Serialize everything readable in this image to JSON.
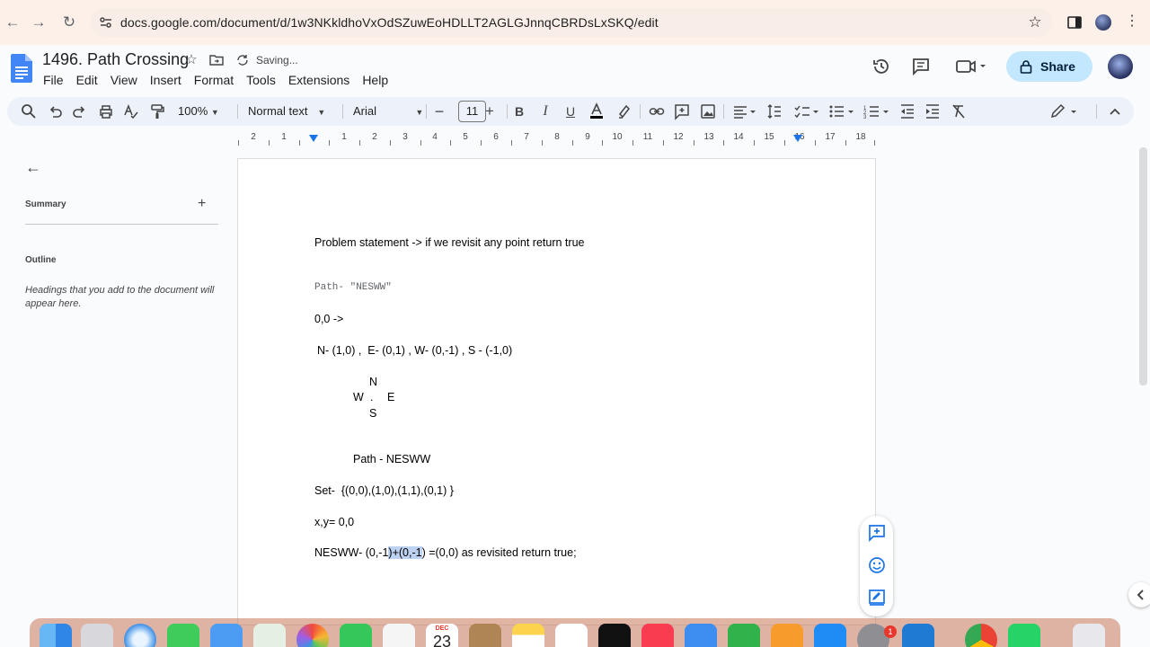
{
  "browser": {
    "url": "docs.google.com/document/d/1w3NKkldhoVxOdSZuwEoHDLLT2AGLGJnnqCBRDsLxSKQ/edit"
  },
  "doc": {
    "title": "1496. Path Crossing",
    "status": "Saving...",
    "share_label": "Share",
    "menu": [
      "File",
      "Edit",
      "View",
      "Insert",
      "Format",
      "Tools",
      "Extensions",
      "Help"
    ]
  },
  "toolbar": {
    "zoom": "100%",
    "style": "Normal text",
    "font": "Arial",
    "font_size": "11"
  },
  "ruler": {
    "labels": [
      "2",
      "1",
      "1",
      "2",
      "3",
      "4",
      "5",
      "6",
      "7",
      "8",
      "9",
      "10",
      "11",
      "12",
      "13",
      "14",
      "15",
      "16",
      "17",
      "18"
    ]
  },
  "sidebar": {
    "summary_label": "Summary",
    "outline_label": "Outline",
    "outline_hint": "Headings that you add to the document will appear here."
  },
  "content": {
    "line1": "Problem statement -> if we revisit any point return true",
    "line2": "Path- \"NESWW\"",
    "line3": "0,0 ->",
    "line4": "N- (1,0) ,  E- (0,1) , W- (0,-1) , S - (-1,0)",
    "compass_n": "N",
    "compass_w": "W",
    "compass_dot": ".",
    "compass_e": "E",
    "compass_s": "S",
    "line5": "Path - NESWW",
    "line6": "Set-  {(0,0),(1,0),(1,1),(0,1) }",
    "line7": "x,y= 0,0",
    "line8_pre": "NESWW- (0,-1",
    "line8_hl": ")+(0,-1",
    "line8_post": ") =(0,0) as revisited return true;"
  },
  "dock": {
    "calendar_month": "DEC",
    "calendar_day": "23",
    "badge_count": "1"
  }
}
